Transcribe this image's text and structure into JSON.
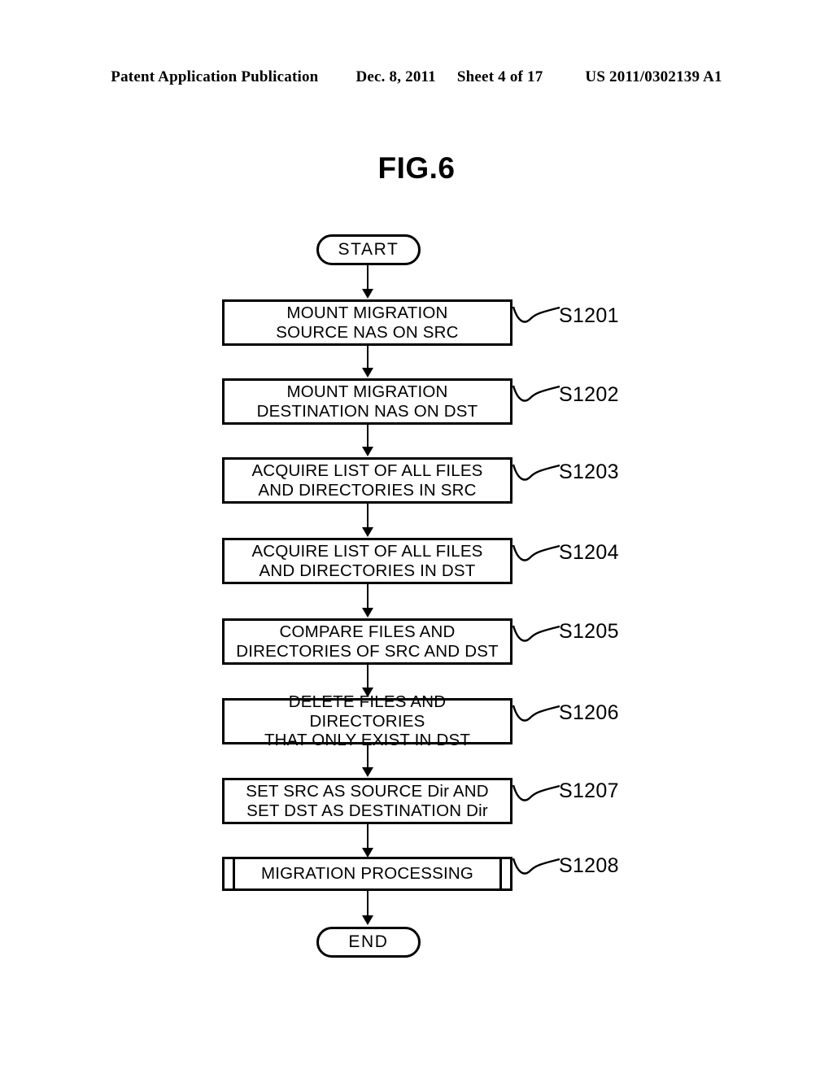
{
  "header": {
    "publication": "Patent Application Publication",
    "date": "Dec. 8, 2011",
    "sheet": "Sheet 4 of 17",
    "patent_number": "US 2011/0302139 A1"
  },
  "figure": {
    "title": "FIG.6",
    "type": "flowchart",
    "line_color": "#000000",
    "background_color": "#ffffff"
  },
  "flowchart": {
    "start_label": "START",
    "end_label": "END",
    "steps": [
      {
        "id": "S1201",
        "shape": "process",
        "line1": "MOUNT MIGRATION",
        "line2": "SOURCE NAS ON SRC"
      },
      {
        "id": "S1202",
        "shape": "process",
        "line1": "MOUNT MIGRATION",
        "line2": "DESTINATION NAS ON DST"
      },
      {
        "id": "S1203",
        "shape": "process",
        "line1": "ACQUIRE LIST OF ALL FILES",
        "line2": "AND DIRECTORIES IN SRC"
      },
      {
        "id": "S1204",
        "shape": "process",
        "line1": "ACQUIRE LIST OF ALL FILES",
        "line2": "AND DIRECTORIES IN DST"
      },
      {
        "id": "S1205",
        "shape": "process",
        "line1": "COMPARE FILES AND",
        "line2": "DIRECTORIES OF SRC AND DST"
      },
      {
        "id": "S1206",
        "shape": "process",
        "line1": "DELETE FILES AND DIRECTORIES",
        "line2": "THAT ONLY EXIST IN DST"
      },
      {
        "id": "S1207",
        "shape": "process",
        "line1": "SET SRC AS SOURCE Dir AND",
        "line2": "SET DST AS DESTINATION Dir"
      },
      {
        "id": "S1208",
        "shape": "predefined-process",
        "line1": "MIGRATION PROCESSING",
        "line2": ""
      }
    ]
  }
}
